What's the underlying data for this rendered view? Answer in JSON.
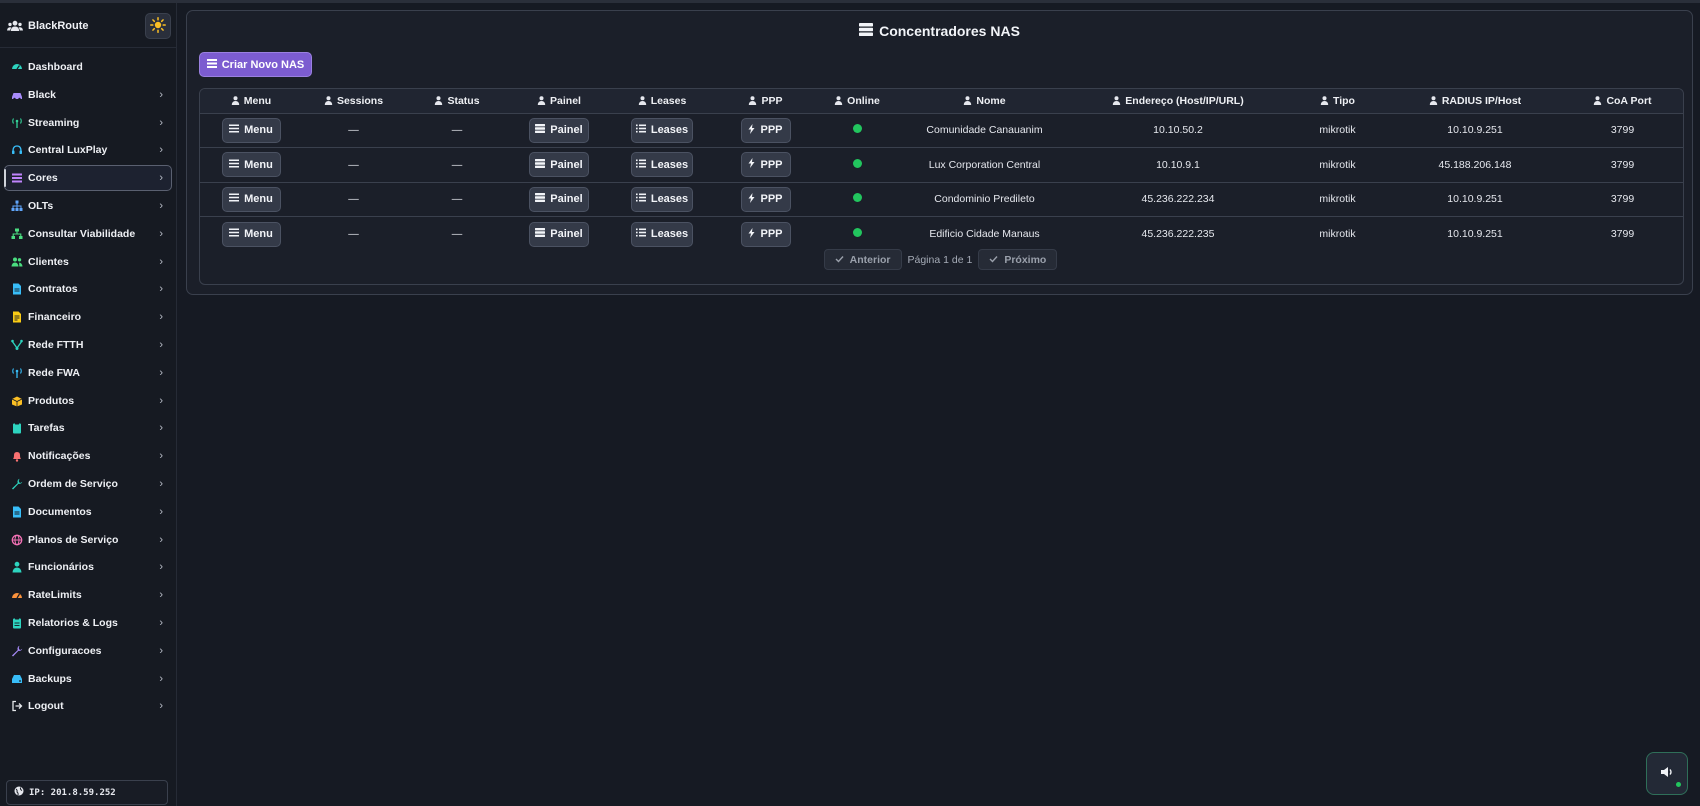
{
  "brand": {
    "name": "BlackRoute"
  },
  "colors": {
    "accent": "#7c5cd0",
    "online": "#22c55e",
    "background": "#161a23"
  },
  "sidebar": {
    "items": [
      {
        "label": "Dashboard",
        "icon": "dashboard-icon",
        "color": "#2dd4bf",
        "chevron": false
      },
      {
        "label": "Black",
        "icon": "car-icon",
        "color": "#a78bfa",
        "chevron": true
      },
      {
        "label": "Streaming",
        "icon": "antenna-icon",
        "color": "#34d399",
        "chevron": true
      },
      {
        "label": "Central LuxPlay",
        "icon": "headset-icon",
        "color": "#38bdf8",
        "chevron": true
      },
      {
        "label": "Cores",
        "icon": "list-icon",
        "color": "#c084fc",
        "chevron": true,
        "active": true
      },
      {
        "label": "OLTs",
        "icon": "sitemap-icon",
        "color": "#60a5fa",
        "chevron": true
      },
      {
        "label": "Consultar Viabilidade",
        "icon": "network-icon",
        "color": "#4ade80",
        "chevron": true
      },
      {
        "label": "Clientes",
        "icon": "users-icon",
        "color": "#4ade80",
        "chevron": true
      },
      {
        "label": "Contratos",
        "icon": "file-icon",
        "color": "#38bdf8",
        "chevron": true
      },
      {
        "label": "Financeiro",
        "icon": "invoice-icon",
        "color": "#facc15",
        "chevron": true
      },
      {
        "label": "Rede FTTH",
        "icon": "fiber-icon",
        "color": "#2dd4bf",
        "chevron": true
      },
      {
        "label": "Rede FWA",
        "icon": "antenna-icon",
        "color": "#38bdf8",
        "chevron": true
      },
      {
        "label": "Produtos",
        "icon": "box-icon",
        "color": "#fbbf24",
        "chevron": true
      },
      {
        "label": "Tarefas",
        "icon": "clipboard-icon",
        "color": "#2dd4bf",
        "chevron": true
      },
      {
        "label": "Notificações",
        "icon": "bell-icon",
        "color": "#f87171",
        "chevron": true
      },
      {
        "label": "Ordem de Serviço",
        "icon": "wrench-icon",
        "color": "#2dd4bf",
        "chevron": true
      },
      {
        "label": "Documentos",
        "icon": "document-icon",
        "color": "#38bdf8",
        "chevron": true
      },
      {
        "label": "Planos de Serviço",
        "icon": "globe-icon",
        "color": "#f472b6",
        "chevron": true
      },
      {
        "label": "Funcionários",
        "icon": "person-icon",
        "color": "#2dd4bf",
        "chevron": true
      },
      {
        "label": "RateLimits",
        "icon": "gauge-icon",
        "color": "#fb923c",
        "chevron": true
      },
      {
        "label": "Relatorios & Logs",
        "icon": "report-icon",
        "color": "#2dd4bf",
        "chevron": true
      },
      {
        "label": "Configuracoes",
        "icon": "tools-icon",
        "color": "#a78bfa",
        "chevron": true
      },
      {
        "label": "Backups",
        "icon": "drive-icon",
        "color": "#38bdf8",
        "chevron": true
      },
      {
        "label": "Logout",
        "icon": "logout-icon",
        "color": "#e5e7eb",
        "chevron": true
      }
    ],
    "ip_label": "IP: 201.8.59.252"
  },
  "page": {
    "title": "Concentradores NAS",
    "create_button": "Criar Novo NAS"
  },
  "table": {
    "headers": [
      "Menu",
      "Sessions",
      "Status",
      "Painel",
      "Leases",
      "PPP",
      "Online",
      "Nome",
      "Endereço (Host/IP/URL)",
      "Tipo",
      "RADIUS IP/Host",
      "CoA Port"
    ],
    "button_labels": {
      "menu": "Menu",
      "painel": "Painel",
      "leases": "Leases",
      "ppp": "PPP"
    },
    "rows": [
      {
        "sessions": "—",
        "status": "—",
        "online": true,
        "nome": "Comunidade Canauanim",
        "endereco": "10.10.50.2",
        "tipo": "mikrotik",
        "radius": "10.10.9.251",
        "coa": "3799"
      },
      {
        "sessions": "—",
        "status": "—",
        "online": true,
        "nome": "Lux Corporation Central",
        "endereco": "10.10.9.1",
        "tipo": "mikrotik",
        "radius": "45.188.206.148",
        "coa": "3799"
      },
      {
        "sessions": "—",
        "status": "—",
        "online": true,
        "nome": "Condominio Predileto",
        "endereco": "45.236.222.234",
        "tipo": "mikrotik",
        "radius": "10.10.9.251",
        "coa": "3799"
      },
      {
        "sessions": "—",
        "status": "—",
        "online": true,
        "nome": "Edificio Cidade Manaus",
        "endereco": "45.236.222.235",
        "tipo": "mikrotik",
        "radius": "10.10.9.251",
        "coa": "3799"
      }
    ]
  },
  "pagination": {
    "prev": "Anterior",
    "info": "Página 1 de 1",
    "next": "Próximo"
  }
}
